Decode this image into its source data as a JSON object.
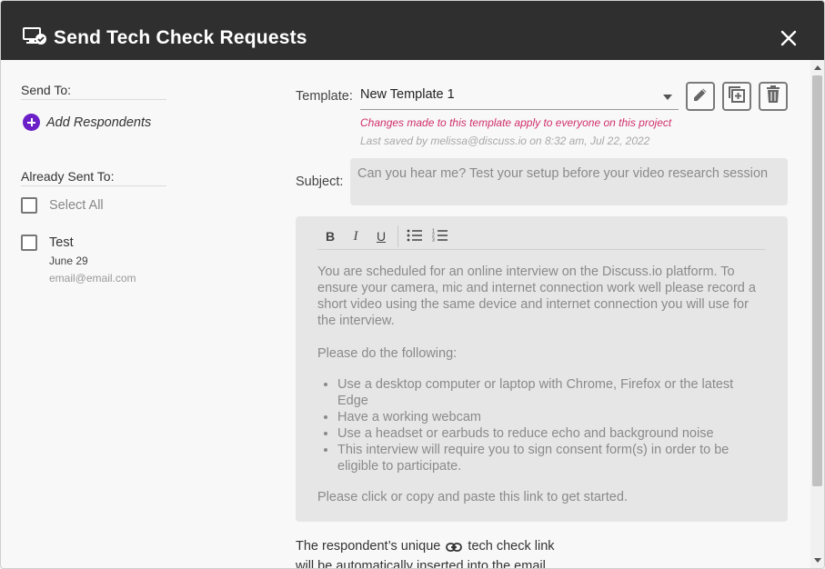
{
  "header": {
    "title": "Send Tech Check Requests",
    "icon": "monitor-check-icon",
    "close_icon": "close-icon"
  },
  "left": {
    "send_to_label": "Send To:",
    "add_respondents_label": "Add Respondents",
    "already_sent_label": "Already Sent To:",
    "select_all_label": "Select All",
    "respondents": [
      {
        "name": "Test",
        "date": "June 29",
        "email": "email@email.com"
      }
    ]
  },
  "template": {
    "label": "Template:",
    "selected": "New Template 1",
    "warning": "Changes made to this template apply to everyone on this project",
    "last_saved": "Last saved by melissa@discuss.io on 8:32 am, Jul 22, 2022"
  },
  "subject": {
    "label": "Subject:",
    "value": "Can you hear me? Test your setup before your video research session"
  },
  "editor": {
    "toolbar": {
      "bold": "B",
      "italic": "I",
      "underline": "U"
    },
    "paragraph1": "You are scheduled for an online interview on the Discuss.io platform. To ensure your camera, mic and internet connection work well please record a short video using the same device and internet connection you will use for the interview.",
    "paragraph2": "Please do the following:",
    "bullets": [
      "Use a desktop computer or laptop with Chrome, Firefox or the latest Edge",
      "Have a working webcam",
      "Use a headset or earbuds to reduce echo and background noise",
      "This interview will require you to sign consent form(s) in order to be eligible to participate."
    ],
    "paragraph3": "Please click or copy and paste this link to get started."
  },
  "footer": {
    "text_before": "The respondent’s unique",
    "text_after": "tech check link",
    "line2": "will be automatically inserted into the email"
  },
  "colors": {
    "header_bg": "#2f2f2f",
    "accent_purple": "#6a1fc7",
    "warning_pink": "#d0306c",
    "editor_bg": "#e6e6e6"
  }
}
